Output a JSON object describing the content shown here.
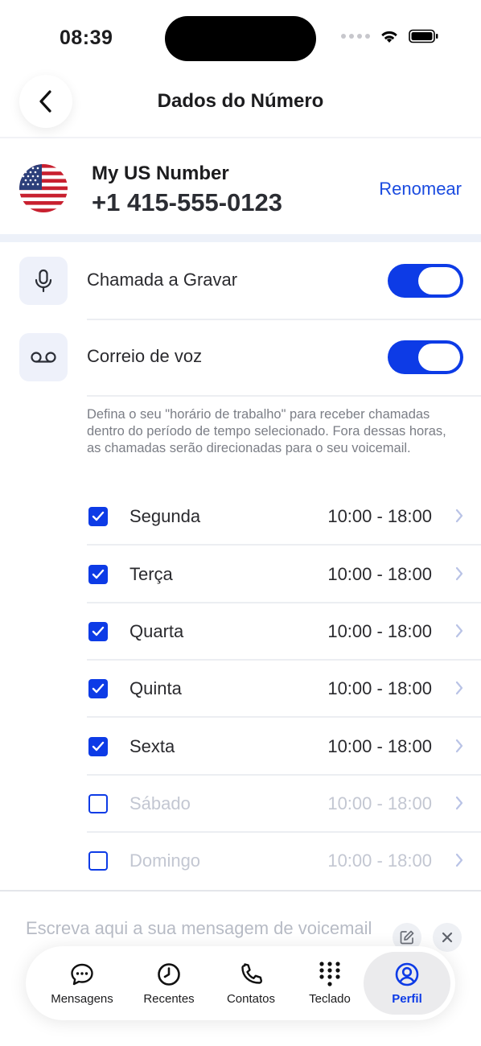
{
  "status_bar": {
    "time": "08:39"
  },
  "header": {
    "title": "Dados do Número"
  },
  "number": {
    "name": "My US Number",
    "value": "+1 415-555-0123",
    "rename_label": "Renomear",
    "flag": "us-flag-icon"
  },
  "settings": [
    {
      "label": "Chamada a Gravar",
      "icon": "microphone-icon",
      "enabled": true
    },
    {
      "label": "Correio de voz",
      "icon": "voicemail-icon",
      "enabled": true
    }
  ],
  "info_text": "Defina o seu \"horário de trabalho\" para receber chamadas dentro do período de tempo selecionado. Fora dessas horas, as chamadas serão direcionadas para o seu voicemail.",
  "days": [
    {
      "name": "Segunda",
      "hours": "10:00 - 18:00",
      "checked": true
    },
    {
      "name": "Terça",
      "hours": "10:00 - 18:00",
      "checked": true
    },
    {
      "name": "Quarta",
      "hours": "10:00 - 18:00",
      "checked": true
    },
    {
      "name": "Quinta",
      "hours": "10:00 - 18:00",
      "checked": true
    },
    {
      "name": "Sexta",
      "hours": "10:00 - 18:00",
      "checked": true
    },
    {
      "name": "Sábado",
      "hours": "10:00 - 18:00",
      "checked": false
    },
    {
      "name": "Domingo",
      "hours": "10:00 - 18:00",
      "checked": false
    }
  ],
  "message": {
    "placeholder": "Escreva aqui a sua mensagem de voicemail"
  },
  "tabs": [
    {
      "label": "Mensagens",
      "icon": "chat-bubble-icon",
      "active": false
    },
    {
      "label": "Recentes",
      "icon": "clock-icon",
      "active": false
    },
    {
      "label": "Contatos",
      "icon": "phone-icon",
      "active": false
    },
    {
      "label": "Teclado",
      "icon": "keypad-icon",
      "active": false
    },
    {
      "label": "Perfil",
      "icon": "profile-icon",
      "active": true
    }
  ],
  "colors": {
    "accent": "#0D3BE6",
    "link": "#1A4BE0",
    "disabled_text": "#C3C7D2",
    "icon_bg": "#EEF1FA"
  }
}
